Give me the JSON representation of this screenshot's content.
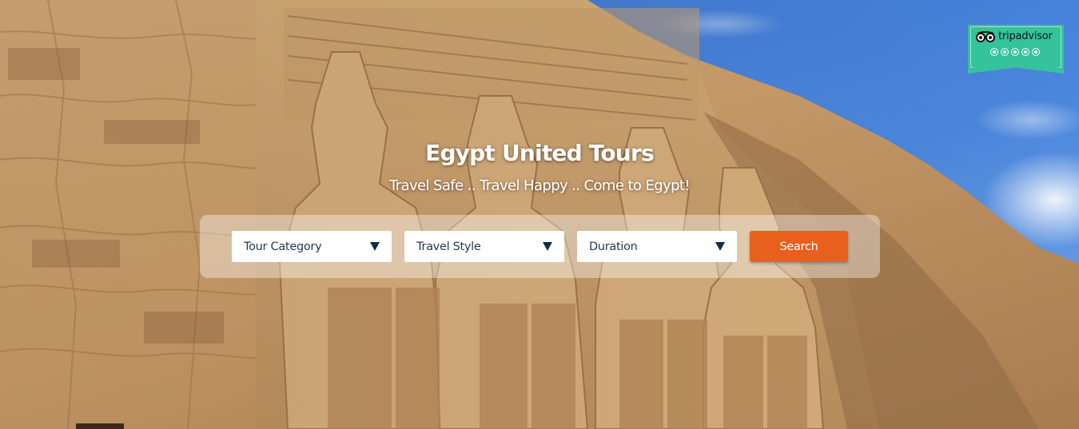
{
  "hero": {
    "title": "Egypt United Tours",
    "subtitle": "Travel Safe .. Travel Happy .. Come to Egypt!"
  },
  "search": {
    "tour_category": "Tour Category",
    "travel_style": "Travel Style",
    "duration": "Duration",
    "button_label": "Search"
  },
  "tripadvisor": {
    "name": "tripadvisor",
    "rating_circles": 5
  },
  "colors": {
    "accent_button": "#e8601c",
    "select_arrow": "#0e2d48",
    "tripadvisor_green": "#34c39a",
    "sky": "#3d7bd9",
    "sandstone": "#c79c6c"
  },
  "icons": {
    "dropdown": "chevron-down-icon",
    "tripadvisor": "owl-icon"
  }
}
